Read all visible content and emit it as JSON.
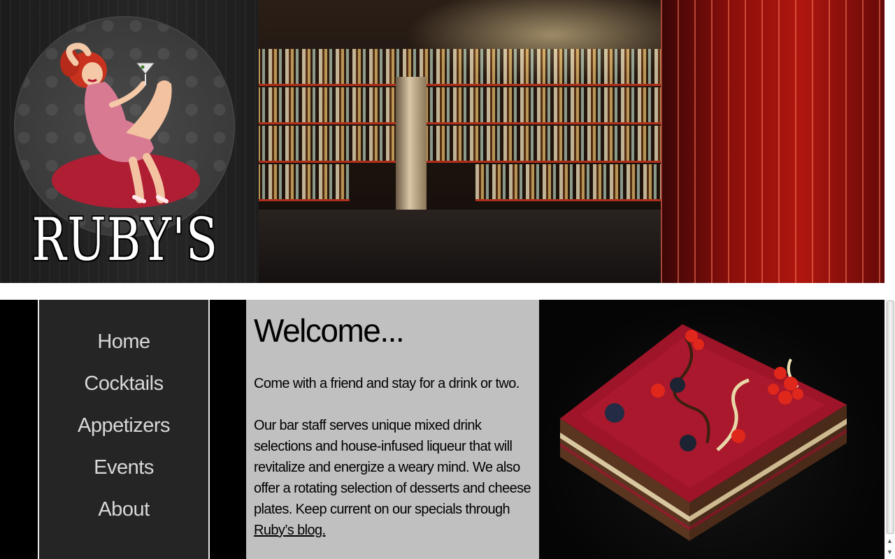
{
  "header": {
    "brand_name": "RUBY'S"
  },
  "nav": {
    "items": [
      {
        "label": "Home"
      },
      {
        "label": "Cocktails"
      },
      {
        "label": "Appetizers"
      },
      {
        "label": "Events"
      },
      {
        "label": "About"
      }
    ]
  },
  "content": {
    "heading": "Welcome...",
    "intro": "Come with a friend and stay for a drink or two.",
    "body": "Our bar staff serves unique mixed drink selections and house-infused liqueur that will revitalize and energize a weary mind. We also offer a rotating selection of desserts and cheese plates. Keep current on our specials through ",
    "blog_link": "Ruby’s blog."
  },
  "colors": {
    "nav_bg": "#252525",
    "nav_text": "#d8d8d8",
    "content_bg": "#c0c0c0",
    "accent_red": "#b01e34"
  },
  "icons": {
    "scroll_up": "▲",
    "scroll_down": "▼"
  }
}
